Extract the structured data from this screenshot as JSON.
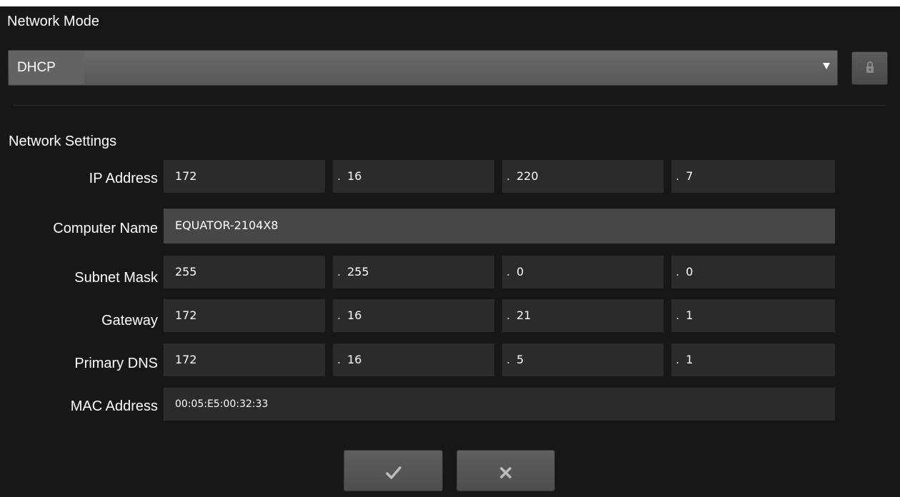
{
  "network_mode": {
    "label": "Network Mode",
    "selected": "DHCP"
  },
  "network_settings": {
    "label": "Network Settings",
    "ip_address": {
      "label": "IP Address",
      "octets": [
        "172",
        "16",
        "220",
        "7"
      ]
    },
    "computer_name": {
      "label": "Computer Name",
      "value": "EQUATOR-2104X8"
    },
    "subnet_mask": {
      "label": "Subnet Mask",
      "octets": [
        "255",
        "255",
        "0",
        "0"
      ]
    },
    "gateway": {
      "label": "Gateway",
      "octets": [
        "172",
        "16",
        "21",
        "1"
      ]
    },
    "primary_dns": {
      "label": "Primary DNS",
      "octets": [
        "172",
        "16",
        "5",
        "1"
      ]
    },
    "mac_address": {
      "label": "MAC Address",
      "value": "00:05:E5:00:32:33"
    }
  },
  "buttons": {
    "confirm_icon": "checkmark-icon",
    "cancel_icon": "close-icon",
    "lock_icon": "lock-icon"
  },
  "colors": {
    "background": "#171717",
    "field": "#2b2b2b",
    "select": "#5f5f5f"
  }
}
